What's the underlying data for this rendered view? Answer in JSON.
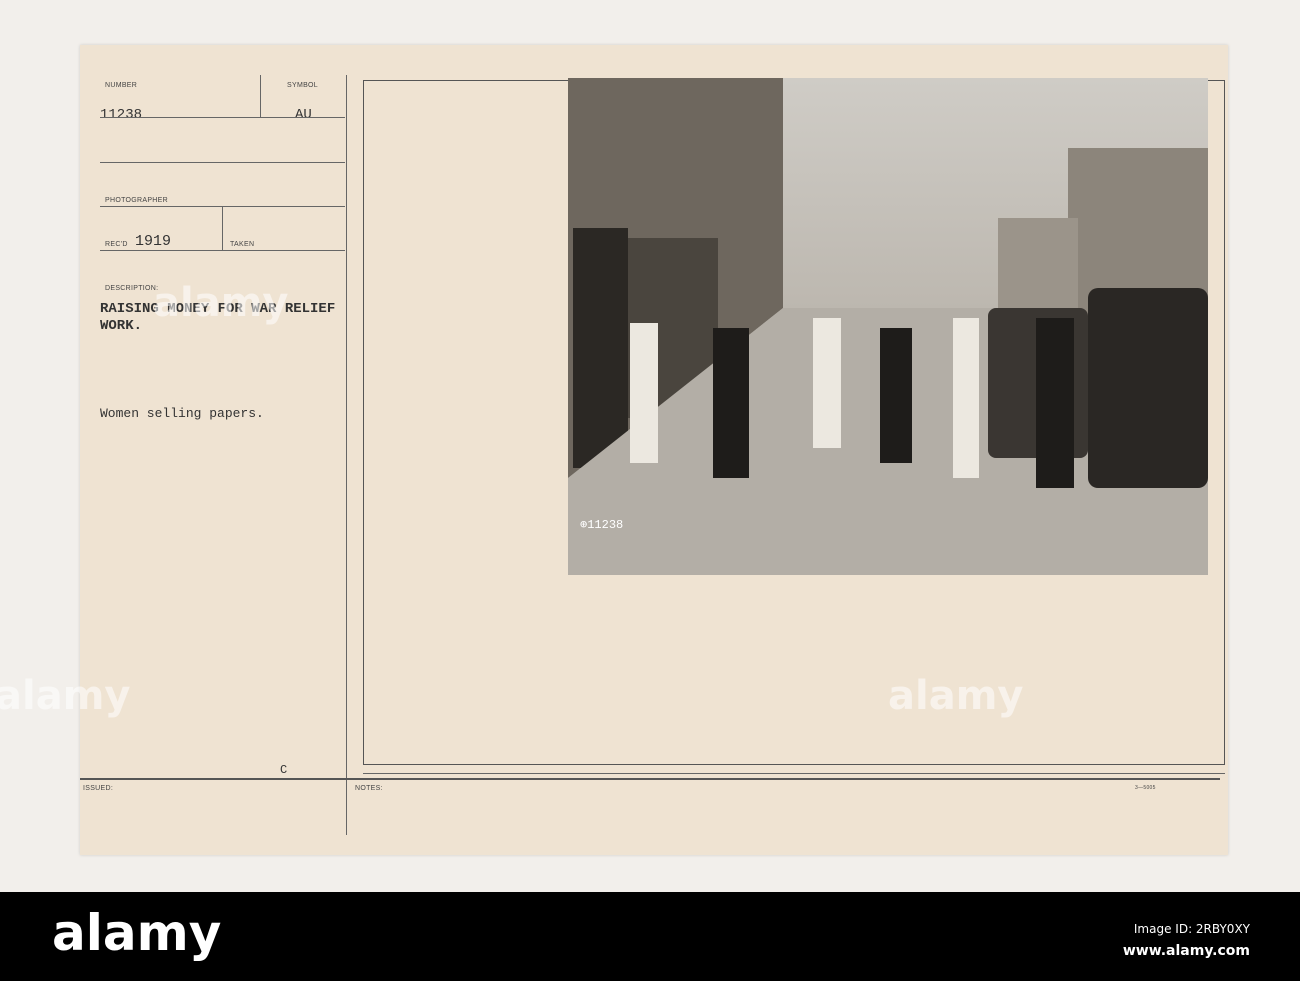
{
  "card": {
    "number_label": "NUMBER",
    "number": "11238",
    "symbol_label": "SYMBOL",
    "symbol": "AU",
    "photographer_label": "PHOTOGRAPHER",
    "recd_label": "REC'D",
    "recd": "1919",
    "taken_label": "TAKEN",
    "description_label": "DESCRIPTION:",
    "description_line1": "RAISING MONEY FOR WAR RELIEF",
    "description_line2": "WORK.",
    "caption": "Women selling papers.",
    "issued_label": "ISSUED:",
    "issued_mark": "C",
    "notes_label": "NOTES:",
    "form_number": "3—5005",
    "photo_number": "⊕11238"
  },
  "watermark": "alamy",
  "footer": {
    "logo": "alamy",
    "image_id": "Image ID: 2RBY0XY",
    "url": "www.alamy.com"
  }
}
